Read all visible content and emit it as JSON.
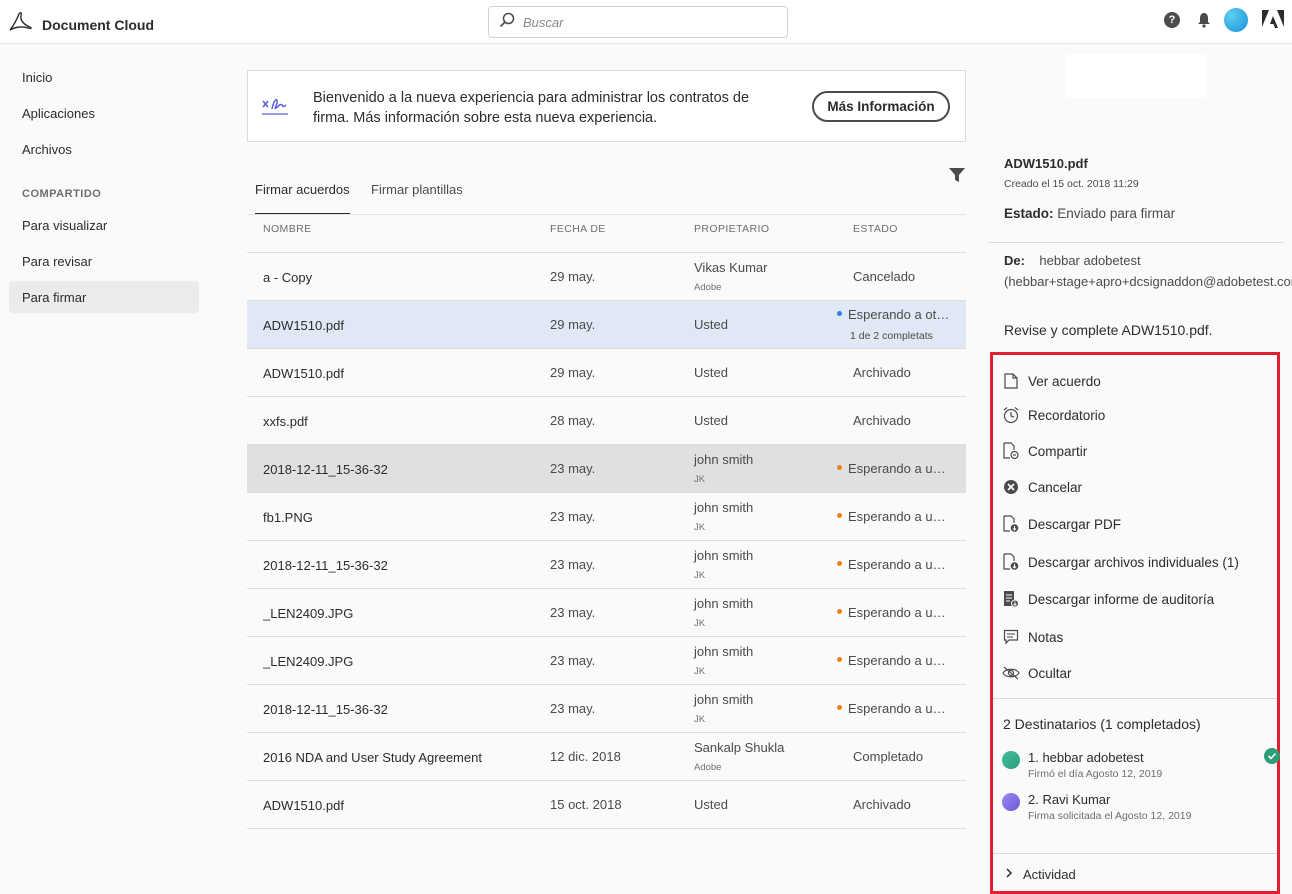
{
  "header": {
    "app_title": "Document Cloud",
    "search_placeholder": "Buscar",
    "help_glyph": "?"
  },
  "sidebar": {
    "items": [
      {
        "label": "Inicio"
      },
      {
        "label": "Aplicaciones"
      },
      {
        "label": "Archivos"
      }
    ],
    "section_label": "COMPARTIDO",
    "shared_items": [
      {
        "label": "Para visualizar"
      },
      {
        "label": "Para revisar"
      },
      {
        "label": "Para firmar",
        "active": true
      }
    ]
  },
  "banner": {
    "text": "Bienvenido a la nueva experiencia para administrar los contratos de firma. Más información sobre esta nueva experiencia.",
    "button_label": "Más Información"
  },
  "tabs": [
    {
      "label": "Firmar acuerdos",
      "active": true
    },
    {
      "label": "Firmar plantillas",
      "active": false
    }
  ],
  "table": {
    "columns": [
      "NOMBRE",
      "FECHA DE",
      "PROPIETARIO",
      "ESTADO"
    ],
    "rows": [
      {
        "name": "a - Copy",
        "date": "29 may.",
        "owner": "Vikas Kumar",
        "owner_sub": "Adobe",
        "status": "Cancelado"
      },
      {
        "name": "ADW1510.pdf",
        "date": "29 may.",
        "owner": "Usted",
        "owner_sub": "",
        "status": "Esperando a otros",
        "status_sub": "1 de 2 completats",
        "dot": "#2680eb"
      },
      {
        "name": "ADW1510.pdf",
        "date": "29 may.",
        "owner": "Usted",
        "owner_sub": "",
        "status": "Archivado"
      },
      {
        "name": "xxfs.pdf",
        "date": "28 may.",
        "owner": "Usted",
        "owner_sub": "",
        "status": "Archivado"
      },
      {
        "name": "2018-12-11_15-36-32",
        "date": "23 may.",
        "owner": "john smith",
        "owner_sub": "JK",
        "status": "Esperando a usted",
        "dot": "#e68619"
      },
      {
        "name": "fb1.PNG",
        "date": "23 may.",
        "owner": "john smith",
        "owner_sub": "JK",
        "status": "Esperando a usted",
        "dot": "#e68619"
      },
      {
        "name": "2018-12-11_15-36-32",
        "date": "23 may.",
        "owner": "john smith",
        "owner_sub": "JK",
        "status": "Esperando a usted",
        "dot": "#e68619"
      },
      {
        "name": "_LEN2409.JPG",
        "date": "23 may.",
        "owner": "john smith",
        "owner_sub": "JK",
        "status": "Esperando a usted",
        "dot": "#e68619"
      },
      {
        "name": "_LEN2409.JPG",
        "date": "23 may.",
        "owner": "john smith",
        "owner_sub": "JK",
        "status": "Esperando a usted",
        "dot": "#e68619"
      },
      {
        "name": "2018-12-11_15-36-32",
        "date": "23 may.",
        "owner": "john smith",
        "owner_sub": "JK",
        "status": "Esperando a usted",
        "dot": "#e68619"
      },
      {
        "name": "2016 NDA and User Study Agreement",
        "date": "12 dic. 2018",
        "owner": "Sankalp Shukla",
        "owner_sub": "Adobe",
        "status": "Completado"
      },
      {
        "name": "ADW1510.pdf",
        "date": "15 oct. 2018",
        "owner": "Usted",
        "owner_sub": "",
        "status": "Archivado"
      }
    ]
  },
  "details": {
    "title": "ADW1510.pdf",
    "created": "Creado el 15 oct. 2018 11:29",
    "status_label": "Estado:",
    "status_value": "Enviado para firmar",
    "from_label": "De:",
    "from_value": "hebbar adobetest (hebbar+stage+apro+dcsignaddon@adobetest.com)",
    "message": "Revise y complete ADW1510.pdf.",
    "actions": [
      {
        "label": "Ver acuerdo",
        "icon": "document-icon"
      },
      {
        "label": "Recordatorio",
        "icon": "alarm-clock-icon"
      },
      {
        "label": "Compartir",
        "icon": "share-document-icon"
      },
      {
        "label": "Cancelar",
        "icon": "cancel-circle-icon"
      },
      {
        "label": "Descargar PDF",
        "icon": "download-pdf-icon"
      },
      {
        "label": "Descargar archivos individuales (1)",
        "icon": "download-files-icon"
      },
      {
        "label": "Descargar informe de auditoría",
        "icon": "audit-report-icon"
      },
      {
        "label": "Notas",
        "icon": "notes-icon"
      },
      {
        "label": "Ocultar",
        "icon": "hide-eye-icon"
      }
    ],
    "recipients_title": "2 Destinatarios (1 completados)",
    "recipients": [
      {
        "name": "1. hebbar adobetest",
        "sub": "Firmó el día Agosto 12, 2019",
        "color": "#2d9d78",
        "signed": true
      },
      {
        "name": "2. Ravi Kumar",
        "sub": "Firma solicitada el Agosto 12, 2019",
        "color": "#7d6be0",
        "signed": false
      }
    ],
    "activity_label": "Actividad"
  },
  "colors": {
    "highlight_border": "#e02030",
    "selected_row": "#dfe8f4",
    "waiting_dot_blue": "#2680eb",
    "waiting_dot_orange": "#e68619"
  }
}
